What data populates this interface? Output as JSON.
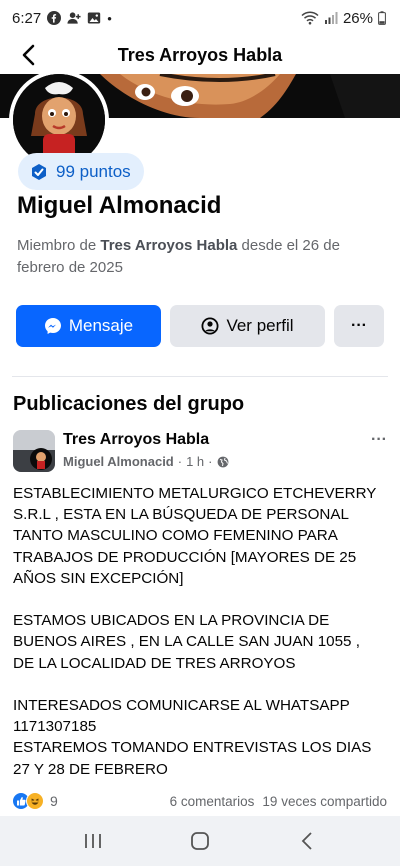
{
  "status_bar": {
    "time": "6:27",
    "battery": "26%",
    "dot": "•"
  },
  "header": {
    "title": "Tres Arroyos Habla"
  },
  "profile": {
    "points": "99 puntos",
    "name": "Miguel Almonacid",
    "member_prefix": "Miembro de ",
    "member_group": "Tres Arroyos Habla",
    "member_suffix": " desde el 26 de febrero de 2025"
  },
  "actions": {
    "message_label": "Mensaje",
    "view_profile_label": "Ver perfil",
    "more_label": "···"
  },
  "section": {
    "title": "Publicaciones del grupo"
  },
  "post": {
    "group": "Tres Arroyos Habla",
    "author": "Miguel Almonacid",
    "time": "1 h",
    "separator": "·",
    "more_label": "···",
    "paragraphs": [
      [
        "ESTABLECIMIENTO METALURGICO ETCHEVERRY",
        "S.R.L , ESTA EN LA BÚSQUEDA DE PERSONAL",
        "TANTO MASCULINO COMO FEMENINO PARA",
        "TRABAJOS DE PRODUCCIÓN [MAYORES DE 25",
        "AÑOS SIN EXCEPCIÓN]"
      ],
      [
        "ESTAMOS UBICADOS EN LA  PROVINCIA DE",
        "BUENOS AIRES , EN LA CALLE SAN JUAN 1055 ,",
        "DE LA LOCALIDAD DE TRES ARROYOS"
      ],
      [
        "INTERESADOS COMUNICARSE AL WHATSAPP",
        "1171307185",
        "ESTAREMOS TOMANDO ENTREVISTAS LOS DIAS",
        "27 Y 28 DE FEBRERO"
      ]
    ],
    "reaction_count": "9",
    "comments": "6 comentarios",
    "shares": "19 veces compartido"
  },
  "colors": {
    "primary": "#0866ff",
    "secondary_button": "#e4e6eb",
    "badge_bg": "#e3effd",
    "badge_text": "#0d5fc7",
    "muted_text": "#65676b"
  },
  "icons": {
    "status_left": [
      "facebook-icon",
      "add-person-icon",
      "gallery-icon"
    ],
    "status_right": [
      "wifi-icon",
      "signal-icon",
      "battery-icon"
    ],
    "nav": [
      "recent-apps-icon",
      "home-icon",
      "back-icon"
    ]
  }
}
